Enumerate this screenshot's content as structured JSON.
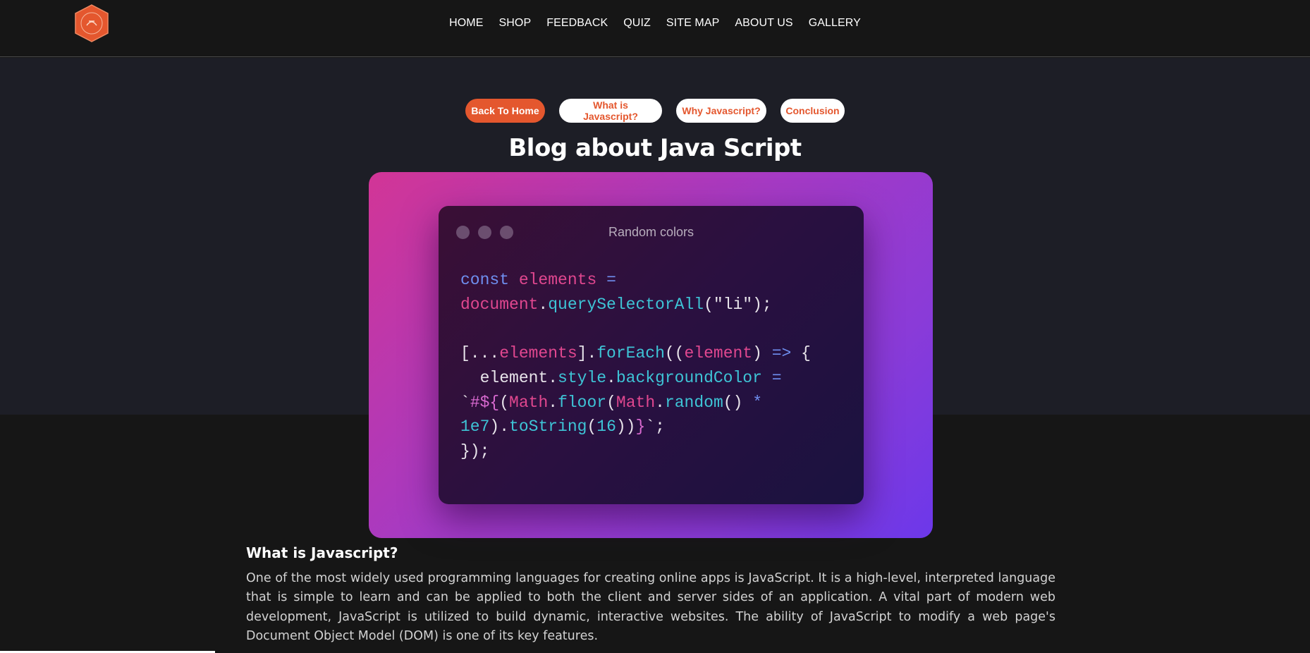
{
  "nav": {
    "logo_icon": "hexagon-logo-icon",
    "links": [
      "HOME",
      "SHOP",
      "FEEDBACK",
      "QUIZ",
      "SITE MAP",
      "ABOUT US",
      "GALLERY"
    ]
  },
  "pills": {
    "back_home": "Back To Home",
    "what_is": "What is Javascript?",
    "why": "Why Javascript?",
    "conclusion": "Conclusion"
  },
  "page": {
    "title": "Blog about Java Script"
  },
  "code_window": {
    "title": "Random colors"
  },
  "section": {
    "heading": "What is Javascript?",
    "body": "One of the most widely used programming languages for creating online apps is JavaScript. It is a high-level, interpreted language that is simple to learn and can be applied to both the client and server sides of an application. A vital part of modern web development, JavaScript is utilized to build dynamic, interactive websites. The ability of JavaScript to modify a web page's Document Object Model (DOM) is one of its key features."
  },
  "colors": {
    "accent": "#e4572e",
    "page_bg": "#161616",
    "hero_bg": "#1d1e26"
  }
}
